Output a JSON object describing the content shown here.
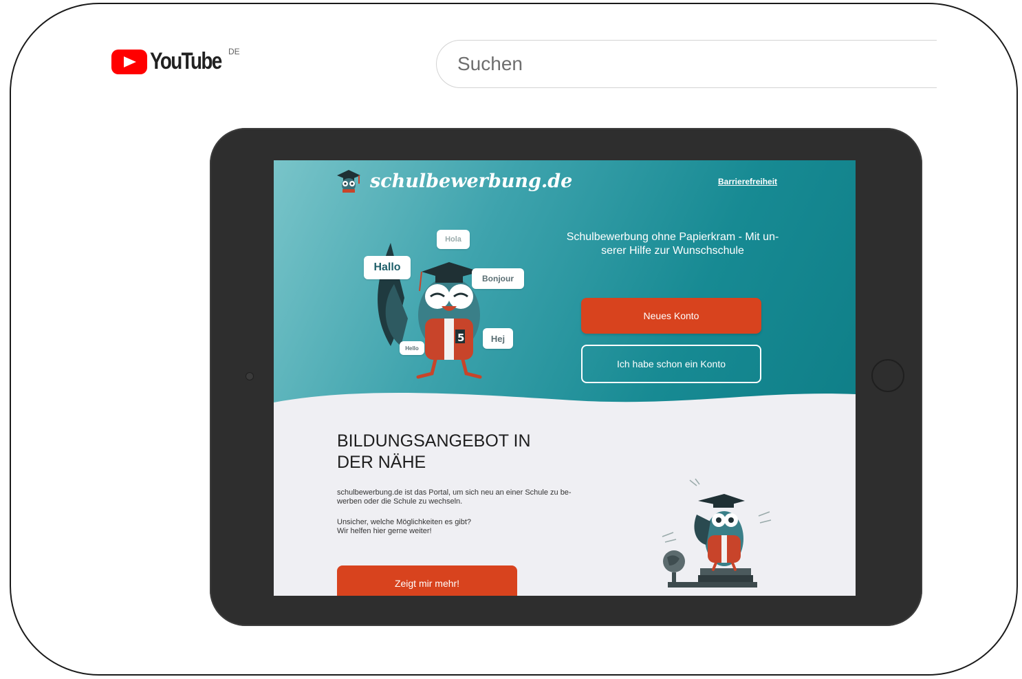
{
  "youtube": {
    "logo_text": "YouTube",
    "country": "DE",
    "search_placeholder": "Suchen",
    "brand_color": "#ff0000"
  },
  "site": {
    "brand": "schulbewerbung.de",
    "accessibility_link": "Barrierefreiheit",
    "tagline_line1": "Schulbewerbung ohne Papierkram - Mit un-",
    "tagline_line2": "serer Hilfe zur Wunschschule",
    "btn_new_account": "Neues Konto",
    "btn_have_account": "Ich habe schon ein Konto",
    "bubbles": {
      "hola": "Hola",
      "hallo": "Hallo",
      "bonjour": "Bonjour",
      "hej": "Hej",
      "hello": "Hello"
    },
    "jersey_number": "5",
    "section_title_line1": "BILDUNGSANGEBOT IN",
    "section_title_line2": "DER NÄHE",
    "section_text_line1": "schulbewerbung.de ist das Portal, um sich neu an einer Schule zu be-",
    "section_text_line2": "werben oder die Schule zu wechseln.",
    "question_line1": "Unsicher, welche Möglichkeiten es gibt?",
    "question_line2": "Wir helfen hier gerne weiter!",
    "btn_more": "Zeigt mir mehr!",
    "colors": {
      "teal": "#178a93",
      "orange": "#d8431e",
      "light_bg": "#efeff3"
    }
  }
}
